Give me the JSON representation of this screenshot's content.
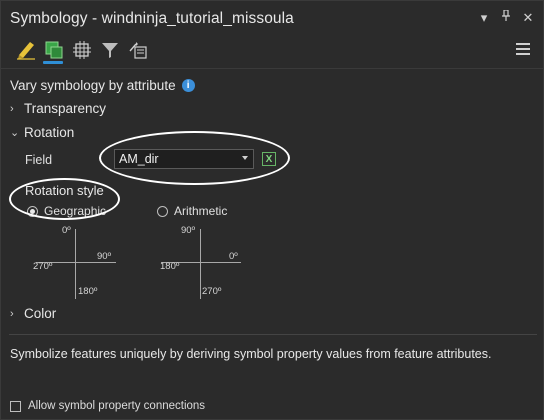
{
  "window": {
    "title": "Symbology - windninja_tutorial_missoula",
    "controls": [
      "dropdown-icon",
      "pin-icon",
      "close-icon"
    ]
  },
  "toolbar": {
    "icons": [
      "primary-symbology-icon",
      "vary-symbology-icon",
      "symbol-layers-icon",
      "filter-icon",
      "display-options-icon"
    ],
    "active_index": 1,
    "accent_color": "#2f8fd6"
  },
  "vary": {
    "heading": "Vary symbology by attribute"
  },
  "sections": {
    "transparency": "Transparency",
    "rotation": "Rotation",
    "color": "Color"
  },
  "rotation": {
    "field_label": "Field",
    "field_value": "AM_dir",
    "rotation_style_label": "Rotation style",
    "options": {
      "geographic": {
        "label": "Geographic",
        "selected": true
      },
      "arithmetic": {
        "label": "Arithmetic",
        "selected": false
      }
    },
    "geographic_compass": {
      "top": "0º",
      "right": "90º",
      "left": "270º",
      "bottom": "180º"
    },
    "arithmetic_compass": {
      "top": "90º",
      "right": "0º",
      "left": "180º",
      "bottom": "270º"
    }
  },
  "description": "Symbolize features uniquely by deriving symbol property values from feature attributes.",
  "checkbox": {
    "label": "Allow symbol property connections",
    "checked": false
  }
}
